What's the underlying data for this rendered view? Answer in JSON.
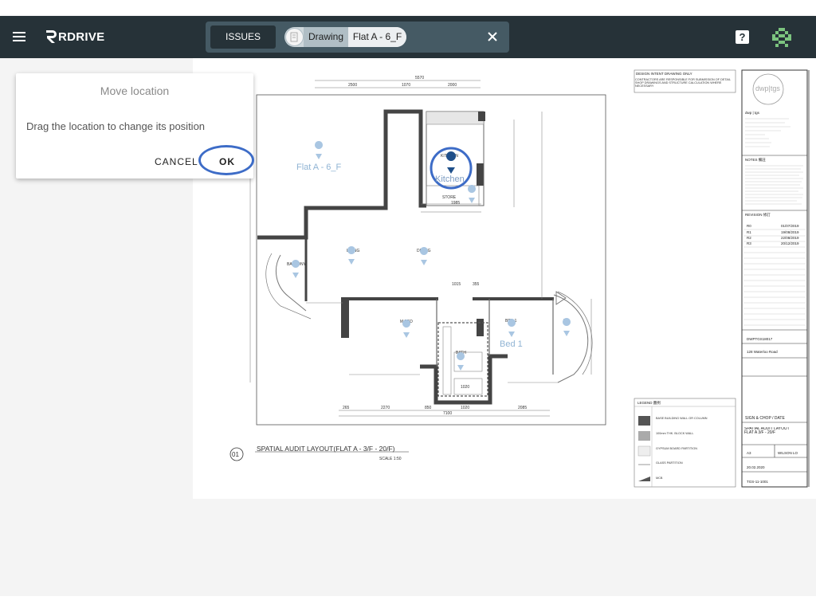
{
  "app": {
    "logo_text": "RDRIVE"
  },
  "header": {
    "issues_label": "ISSUES",
    "chip_type": "Drawing",
    "chip_name": "Flat A - 6_F"
  },
  "dialog": {
    "title": "Move location",
    "message": "Drag the location to change its position",
    "cancel_label": "CANCEL",
    "ok_label": "OK"
  },
  "drawing": {
    "title": "SPATIAL AUDIT LAYOUT(FLAT A - 3/F - 20/F)",
    "number": "01",
    "scale": "SCALE 1:50",
    "rooms": [
      "KITCHEN",
      "STORE",
      "LIVING",
      "DINING",
      "BALCONY",
      "M.BED",
      "BED 1",
      "BATH",
      "UP"
    ],
    "location_labels": {
      "flat": "Flat A - 6_F",
      "kitchen": "Kitchen",
      "bed": "Bed 1"
    },
    "dimensions_top": [
      "5570",
      "2500",
      "1070",
      "2000"
    ],
    "dimensions_bottom": [
      "265",
      "2270",
      "850",
      "1020",
      "2085",
      "7100"
    ],
    "dimensions_misc": [
      "1985",
      "1015",
      "355",
      "1020"
    ],
    "design_intent": "DESIGN INTENT DRAWING ONLY",
    "design_note": "CONTRACTORS ARE RESPONSIBLE FOR SUBMISSION OF DETAIL SHOP DRAWINGS AND STRUCTURE CALCULATION WHERE NECESSARY"
  },
  "titleblock": {
    "logo": "dwp|tgs",
    "company": "dwp | tgs",
    "notes_header": "NOTES 備註",
    "revision_header": "REVISION 修訂",
    "revisions": [
      {
        "no": "R0",
        "date": "01/07/2019"
      },
      {
        "no": "R1",
        "date": "19/08/2019"
      },
      {
        "no": "R2",
        "date": "22/08/2019"
      },
      {
        "no": "R3",
        "date": "20/12/2019"
      }
    ],
    "job_no": "DWPTGS18017",
    "project_name": "128 Waterloo Road",
    "sign_label": "SIGN & CHOP / DATE",
    "drawing_title": "SPATIAL AUDIT LAYOUT FLAT A 3/F - 20/F",
    "scale": "A3",
    "drawn": "WILSON LO",
    "date": "20.02.2020",
    "drawing_no": "TGS-11-1001"
  },
  "legend": {
    "title": "LEGEND 圖例",
    "items": [
      "BASE BUILDING WALL OR COLUMN",
      "100mm THK. BLOCK WALL",
      "GYPSUM BOARD PARTITION",
      "GLASS PARTITION",
      "MCB"
    ]
  },
  "colors": {
    "topbar": "#263238",
    "search": "#455a64",
    "accent": "#3d6cc7"
  }
}
